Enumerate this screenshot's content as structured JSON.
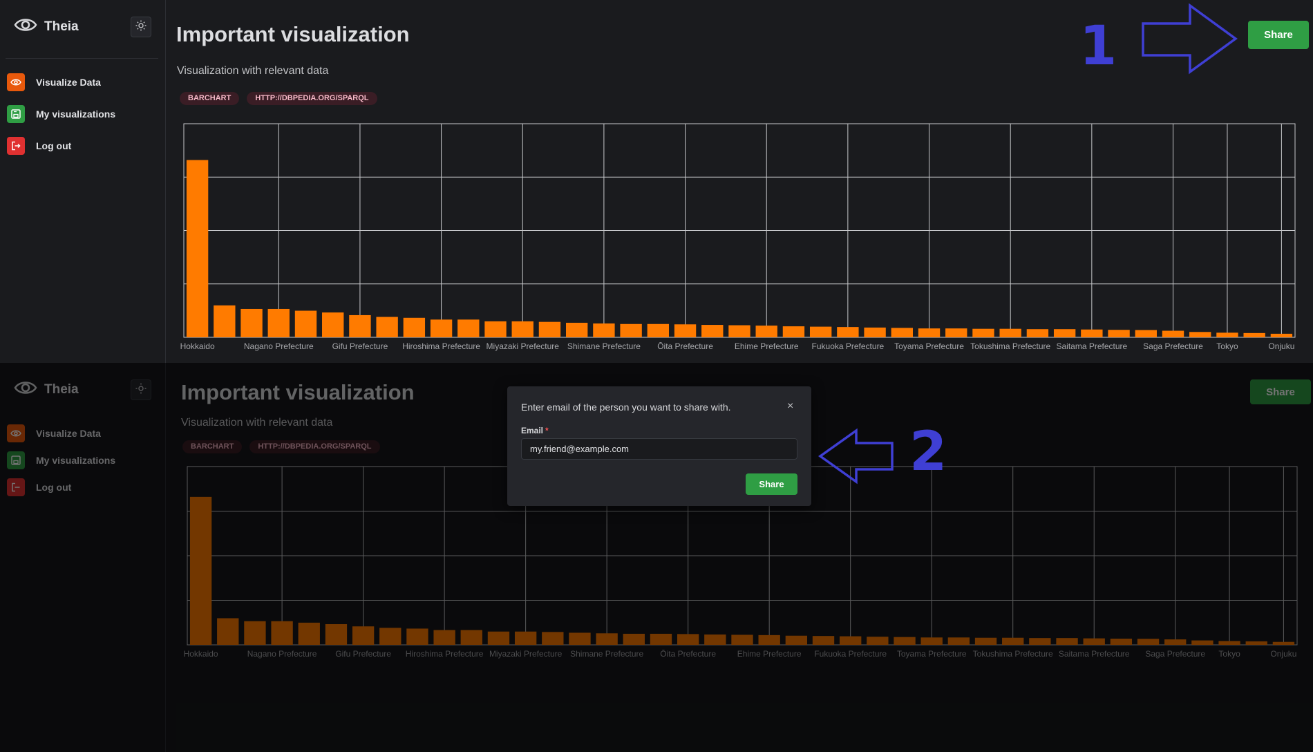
{
  "app": {
    "name": "Theia",
    "logo_icon": "eye-icon",
    "theme_icon": "sun-icon"
  },
  "nav": [
    {
      "label": "Visualize Data",
      "icon": "eye-icon",
      "color": "#e8590c"
    },
    {
      "label": "My visualizations",
      "icon": "save-icon",
      "color": "#2f9e44"
    },
    {
      "label": "Log out",
      "icon": "logout-icon",
      "color": "#e03131"
    }
  ],
  "page": {
    "title": "Important visualization",
    "subtitle": "Visualization with relevant data",
    "badges": [
      "BARCHART",
      "HTTP://DBPEDIA.ORG/SPARQL"
    ],
    "share_label": "Share"
  },
  "annotations": {
    "step1": "1",
    "step2": "2"
  },
  "modal": {
    "title": "Enter email of the person you want to share with.",
    "close": "×",
    "email_label": "Email",
    "required_mark": "*",
    "email_value": "my.friend@example.com",
    "share_label": "Share"
  },
  "colors": {
    "bar": "#ff7b00",
    "accent": "#2f9e44",
    "annotation": "#3f3fd4"
  },
  "chart_data": {
    "type": "bar",
    "categories": [
      "Hokkaido",
      "",
      "",
      "Nagano Prefecture",
      "",
      "",
      "Gifu Prefecture",
      "",
      "",
      "Hiroshima Prefecture",
      "",
      "",
      "Miyazaki Prefecture",
      "",
      "",
      "Shimane Prefecture",
      "",
      "",
      "Ōita Prefecture",
      "",
      "",
      "Ehime Prefecture",
      "",
      "",
      "Fukuoka Prefecture",
      "",
      "",
      "Toyama Prefecture",
      "",
      "",
      "Tokushima Prefecture",
      "",
      "",
      "Saitama Prefecture",
      "",
      "",
      "Saga Prefecture",
      "",
      "Tokyo",
      "",
      "Onjuku"
    ],
    "values": [
      100,
      18,
      16,
      16,
      15,
      14,
      12.5,
      11.5,
      11,
      10,
      10,
      9,
      9,
      8.7,
      8.2,
      7.8,
      7.5,
      7.5,
      7.3,
      7.0,
      6.8,
      6.6,
      6.2,
      6.0,
      5.8,
      5.5,
      5.3,
      5.0,
      5.0,
      4.8,
      4.8,
      4.6,
      4.6,
      4.4,
      4.2,
      4.1,
      3.7,
      3.0,
      2.6,
      2.4,
      2.0
    ],
    "grid": true,
    "title": "",
    "xlabel": "",
    "ylabel": ""
  }
}
